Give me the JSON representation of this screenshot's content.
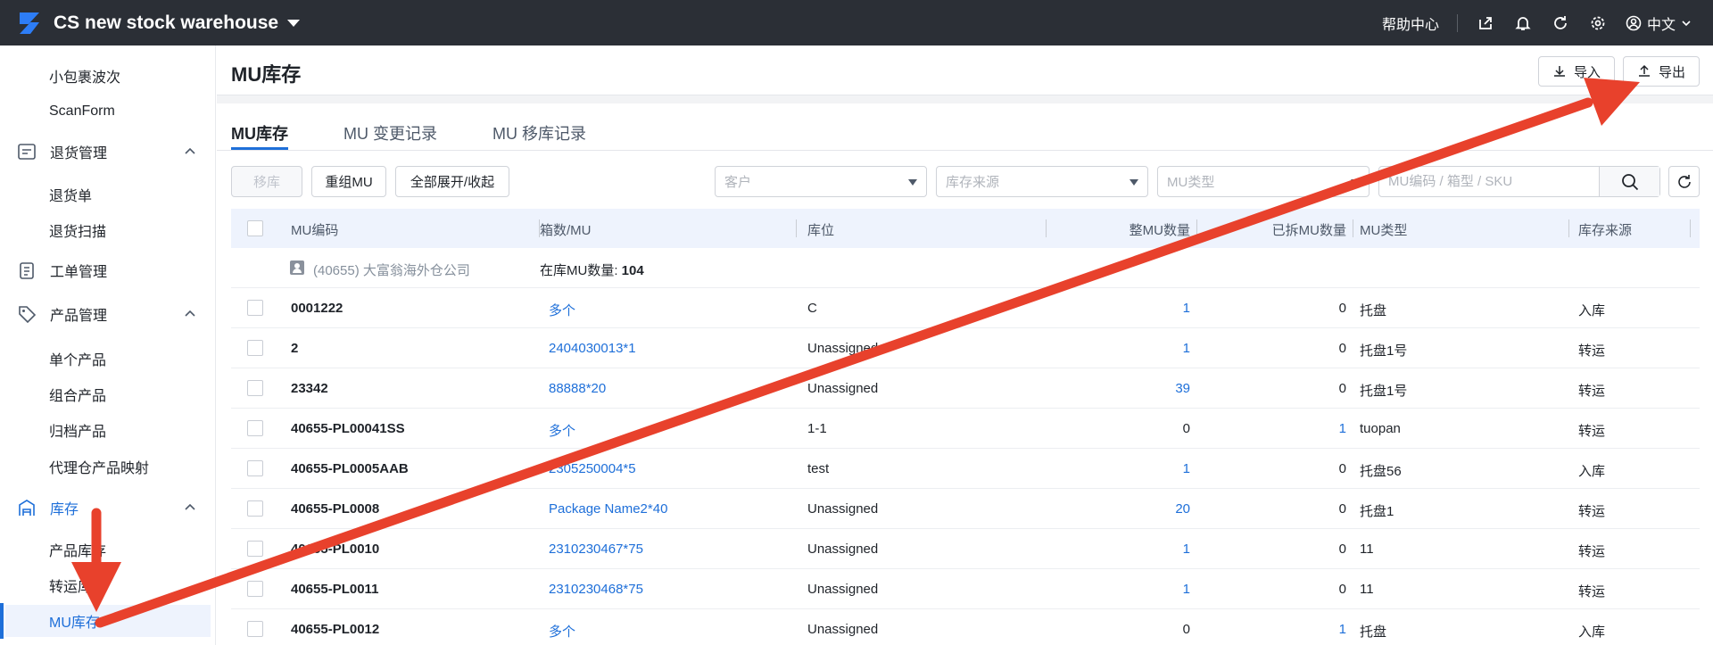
{
  "topbar": {
    "app_title": "CS new stock warehouse",
    "help": "帮助中心",
    "language": "中文"
  },
  "sidebar": {
    "items": [
      {
        "type": "sub",
        "label": "小包裹波次"
      },
      {
        "type": "sub",
        "label": "ScanForm"
      },
      {
        "type": "group",
        "label": "退货管理",
        "icon": "return-icon",
        "expanded": true
      },
      {
        "type": "sub",
        "label": "退货单"
      },
      {
        "type": "sub",
        "label": "退货扫描"
      },
      {
        "type": "group",
        "label": "工单管理",
        "icon": "clipboard-icon"
      },
      {
        "type": "group",
        "label": "产品管理",
        "icon": "tag-icon",
        "expanded": true
      },
      {
        "type": "sub",
        "label": "单个产品"
      },
      {
        "type": "sub",
        "label": "组合产品"
      },
      {
        "type": "sub",
        "label": "归档产品"
      },
      {
        "type": "sub",
        "label": "代理仓产品映射"
      },
      {
        "type": "group",
        "label": "库存",
        "icon": "warehouse-icon",
        "expanded": true,
        "active": true
      },
      {
        "type": "sub",
        "label": "产品库存"
      },
      {
        "type": "sub",
        "label": "转运库存"
      },
      {
        "type": "sub",
        "label": "MU库存",
        "selected": true
      }
    ]
  },
  "page": {
    "title": "MU库存",
    "import_label": "导入",
    "export_label": "导出"
  },
  "tabs": [
    "MU库存",
    "MU 变更记录",
    "MU 移库记录"
  ],
  "toolbar": {
    "move_label": "移库",
    "regroup_label": "重组MU",
    "expand_label": "全部展开/收起",
    "customer_placeholder": "客户",
    "source_placeholder": "库存来源",
    "type_placeholder": "MU类型",
    "search_placeholder": "MU编码 / 箱型 / SKU"
  },
  "table": {
    "headers": [
      "MU编码",
      "箱数/MU",
      "库位",
      "整MU数量",
      "已拆MU数量",
      "MU类型",
      "库存来源"
    ],
    "group": {
      "name": "(40655) 大富翁海外仓公司",
      "count_label": "在库MU数量:",
      "count": "104"
    },
    "rows": [
      {
        "code": "0001222",
        "boxes": "多个",
        "location": "C",
        "whole": "1",
        "split": "0",
        "type": "托盘",
        "source": "入库"
      },
      {
        "code": "2",
        "boxes": "2404030013*1",
        "location": "Unassigned",
        "whole": "1",
        "split": "0",
        "type": "托盘1号",
        "source": "转运"
      },
      {
        "code": "23342",
        "boxes": "88888*20",
        "location": "Unassigned",
        "whole": "39",
        "split": "0",
        "type": "托盘1号",
        "source": "转运"
      },
      {
        "code": "40655-PL00041SS",
        "boxes": "多个",
        "location": "1-1",
        "whole": "0",
        "split": "1",
        "type": "tuopan",
        "source": "转运"
      },
      {
        "code": "40655-PL0005AAB",
        "boxes": "2305250004*5",
        "location": "test",
        "whole": "1",
        "split": "0",
        "type": "托盘56",
        "source": "入库"
      },
      {
        "code": "40655-PL0008",
        "boxes": "Package Name2*40",
        "location": "Unassigned",
        "whole": "20",
        "split": "0",
        "type": "托盘1",
        "source": "转运"
      },
      {
        "code": "40655-PL0010",
        "boxes": "2310230467*75",
        "location": "Unassigned",
        "whole": "1",
        "split": "0",
        "type": "11",
        "source": "转运"
      },
      {
        "code": "40655-PL0011",
        "boxes": "2310230468*75",
        "location": "Unassigned",
        "whole": "1",
        "split": "0",
        "type": "11",
        "source": "转运"
      },
      {
        "code": "40655-PL0012",
        "boxes": "多个",
        "location": "Unassigned",
        "whole": "0",
        "split": "1",
        "type": "托盘",
        "source": "入库"
      }
    ]
  },
  "colors": {
    "accent": "#1e6fd9",
    "annotation": "#e8412c",
    "topbar": "#2b2f36"
  }
}
